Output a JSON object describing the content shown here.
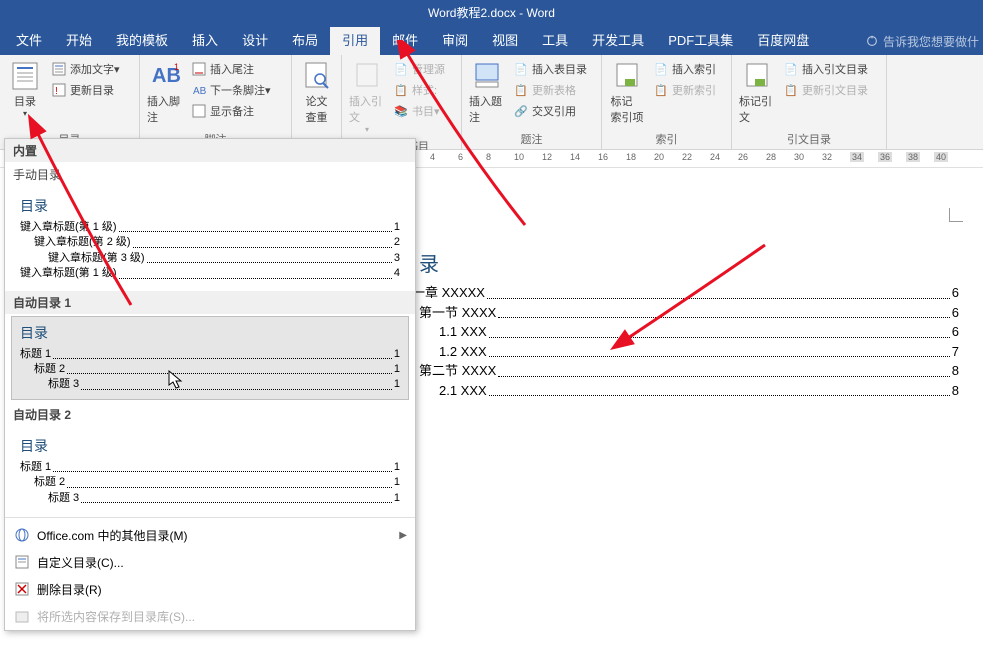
{
  "title": "Word教程2.docx - Word",
  "menus": [
    "文件",
    "开始",
    "我的模板",
    "插入",
    "设计",
    "布局",
    "引用",
    "邮件",
    "审阅",
    "视图",
    "工具",
    "开发工具",
    "PDF工具集",
    "百度网盘"
  ],
  "active_menu": 6,
  "tell_me": "告诉我您想要做什",
  "ribbon": {
    "toc": {
      "big": "目录",
      "add_text": "添加文字",
      "update": "更新目录",
      "label": "目录"
    },
    "footnote": {
      "big": "插入脚注",
      "endnote": "插入尾注",
      "next": "下一条脚注",
      "show": "显示备注",
      "label": "脚注"
    },
    "research": {
      "big": "论文\n查重"
    },
    "cite": {
      "big": "插入引文",
      "manage": "管理源",
      "style": "样式:",
      "biblio": "书目",
      "label": "引文与书目"
    },
    "caption": {
      "big": "插入题注",
      "toc_fig": "插入表目录",
      "update_tbl": "更新表格",
      "cross": "交叉引用",
      "label": "题注"
    },
    "index": {
      "big": "标记\n索引项",
      "insert": "插入索引",
      "update": "更新索引",
      "label": "索引"
    },
    "citation": {
      "big": "标记引文",
      "insert": "插入引文目录",
      "update": "更新引文目录",
      "label": "引文目录"
    }
  },
  "ruler_marks": [
    4,
    6,
    8,
    10,
    12,
    14,
    16,
    18,
    20,
    22,
    24,
    26,
    28,
    30,
    32,
    34,
    36,
    38,
    40
  ],
  "ruler_gray_start": 34,
  "dropdown": {
    "builtin": "内置",
    "manual": "手动目录",
    "auto1": "自动目录 1",
    "auto2": "自动目录 2",
    "pv_title": "目录",
    "manual_rows": [
      {
        "t": "键入章标题(第 1 级)",
        "p": "1",
        "i": 0
      },
      {
        "t": "键入章标题(第 2 级)",
        "p": "2",
        "i": 1
      },
      {
        "t": "键入章标题(第 3 级)",
        "p": "3",
        "i": 2
      },
      {
        "t": "键入章标题(第 1 级)",
        "p": "4",
        "i": 0
      }
    ],
    "auto_rows": [
      {
        "t": "标题 1",
        "p": "1",
        "i": 0
      },
      {
        "t": "标题 2",
        "p": "1",
        "i": 1
      },
      {
        "t": "标题 3",
        "p": "1",
        "i": 2
      }
    ],
    "cmd_office": "Office.com 中的其他目录(M)",
    "cmd_custom": "自定义目录(C)...",
    "cmd_remove": "删除目录(R)",
    "cmd_save": "将所选内容保存到目录库(S)..."
  },
  "page": {
    "heading": "目录",
    "rows": [
      {
        "t": "第一章 XXXXX",
        "p": "6",
        "i": 0
      },
      {
        "t": "第一节 XXXX",
        "p": "6",
        "i": 1
      },
      {
        "t": "1.1 XXX",
        "p": "6",
        "i": 2
      },
      {
        "t": "1.2 XXX",
        "p": "7",
        "i": 2
      },
      {
        "t": "第二节 XXXX",
        "p": "8",
        "i": 1
      },
      {
        "t": "2.1 XXX",
        "p": "8",
        "i": 2
      }
    ]
  }
}
